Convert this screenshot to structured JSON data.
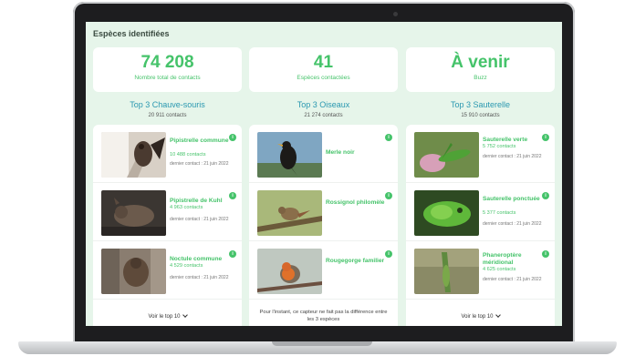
{
  "page": {
    "title": "Espèces identifiées"
  },
  "stats": [
    {
      "value": "74 208",
      "label": "Nombre total de contacts"
    },
    {
      "value": "41",
      "label": "Espèces contactées"
    },
    {
      "value": "À venir",
      "label": "Buzz"
    }
  ],
  "columns": [
    {
      "title": "Top 3 Chauve-souris",
      "count": "20 911 contacts",
      "footer": "Voir le top 10",
      "items": [
        {
          "name": "Pipistrelle commune",
          "contacts": "10 488 contacts",
          "last": "dernier contact : 21 juin 2022",
          "image": "bat-icon"
        },
        {
          "name": "Pipistrelle de Kuhl",
          "contacts": "4 963 contacts",
          "last": "dernier contact : 21 juin 2022",
          "image": "bat-icon"
        },
        {
          "name": "Noctule commune",
          "contacts": "4 529 contacts",
          "last": "dernier contact : 21 juin 2022",
          "image": "bat-icon"
        }
      ]
    },
    {
      "title": "Top 3 Oiseaux",
      "count": "21 274 contacts",
      "footer": "Pour l'instant, ce capteur ne fait pas la différence entre les 3 espèces",
      "items": [
        {
          "name": "Merle noir",
          "contacts": "",
          "last": "",
          "image": "bird-icon"
        },
        {
          "name": "Rossignol philomèle",
          "contacts": "",
          "last": "",
          "image": "bird-icon"
        },
        {
          "name": "Rougegorge familier",
          "contacts": "",
          "last": "",
          "image": "bird-icon"
        }
      ]
    },
    {
      "title": "Top 3 Sauterelle",
      "count": "15 910 contacts",
      "footer": "Voir le top 10",
      "items": [
        {
          "name": "Sauterelle verte",
          "contacts": "5 752 contacts",
          "last": "dernier contact : 21 juin 2022",
          "image": "grasshopper-icon"
        },
        {
          "name": "Sauterelle ponctuée",
          "contacts": "5 377 contacts",
          "last": "dernier contact : 21 juin 2022",
          "image": "grasshopper-icon"
        },
        {
          "name": "Phaneroptère méridional",
          "contacts": "4 625 contacts",
          "last": "dernier contact : 21 juin 2022",
          "image": "grasshopper-icon"
        }
      ]
    }
  ],
  "info_symbol": "i",
  "colors": {
    "accent": "#45c36a",
    "title_blue": "#2a98b0",
    "background": "#e6f5ea"
  }
}
